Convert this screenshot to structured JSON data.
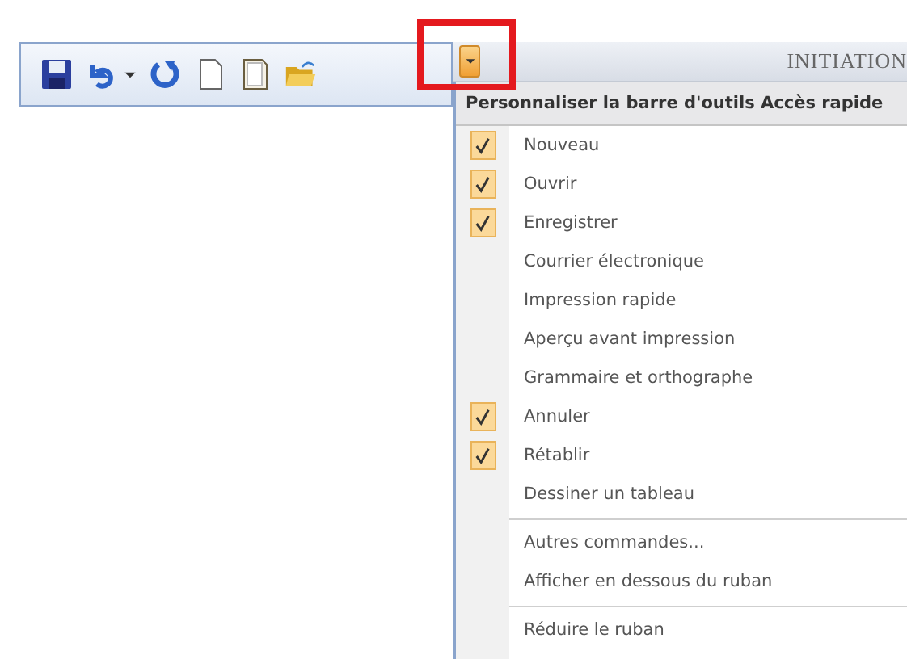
{
  "window": {
    "title": "INITIATION"
  },
  "menu": {
    "title": "Personnaliser la barre d'outils Accès rapide",
    "items": [
      {
        "label": "Nouveau",
        "checked": true,
        "kind": "toggle"
      },
      {
        "label": "Ouvrir",
        "checked": true,
        "kind": "toggle"
      },
      {
        "label": "Enregistrer",
        "checked": true,
        "kind": "toggle"
      },
      {
        "label": "Courrier électronique",
        "checked": false,
        "kind": "toggle"
      },
      {
        "label": "Impression rapide",
        "checked": false,
        "kind": "toggle"
      },
      {
        "label": "Aperçu avant impression",
        "checked": false,
        "kind": "toggle"
      },
      {
        "label": "Grammaire et orthographe",
        "checked": false,
        "kind": "toggle"
      },
      {
        "label": "Annuler",
        "checked": true,
        "kind": "toggle"
      },
      {
        "label": "Rétablir",
        "checked": true,
        "kind": "toggle"
      },
      {
        "label": "Dessiner un tableau",
        "checked": false,
        "kind": "toggle"
      },
      {
        "kind": "separator"
      },
      {
        "label": "Autres commandes...",
        "kind": "command"
      },
      {
        "label": "Afficher en dessous du ruban",
        "kind": "command"
      },
      {
        "kind": "separator"
      },
      {
        "label": "Réduire le ruban",
        "kind": "command"
      }
    ]
  }
}
